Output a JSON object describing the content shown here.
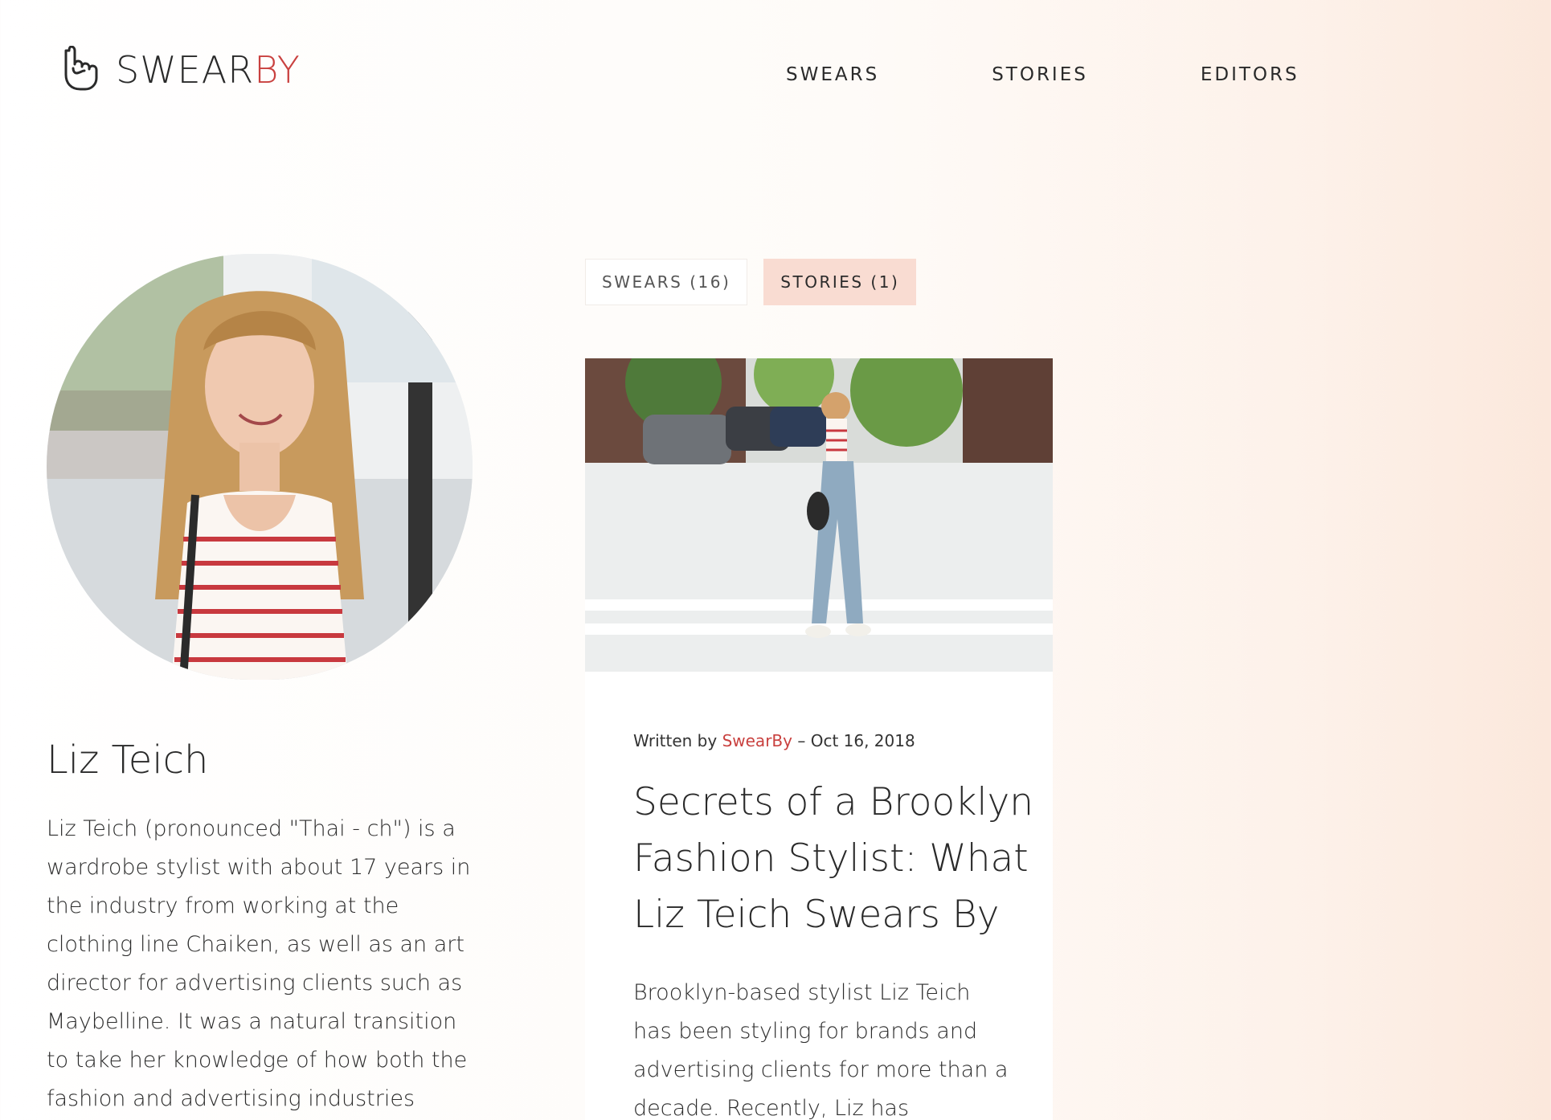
{
  "brand": {
    "name_main": "SWEAR",
    "name_accent": "BY",
    "accent_color": "#c9413f",
    "icon": "hand-icon"
  },
  "nav": {
    "items": [
      {
        "label": "SWEARS"
      },
      {
        "label": "STORIES"
      },
      {
        "label": "EDITORS"
      }
    ]
  },
  "profile": {
    "name": "Liz Teich",
    "bio": "Liz Teich (pronounced \"Thai - ch\") is a wardrobe stylist with about 17 years in the industry from working at the clothing line Chaiken, as well as an art director for advertising clients such as Maybelline. It was a natural transition to take her knowledge of how both the fashion and advertising industries operate and apply it"
  },
  "tabs": [
    {
      "label": "SWEARS (16)",
      "active": false
    },
    {
      "label": "STORIES (1)",
      "active": true
    }
  ],
  "story": {
    "written_by_prefix": "Written by",
    "author": "SwearBy",
    "date_separator": "–",
    "date": "Oct 16, 2018",
    "title": "Secrets of a Brooklyn Fashion Stylist: What Liz Teich Swears By",
    "excerpt": "Brooklyn-based stylist Liz Teich has been styling for brands and advertising clients for more than a decade. Recently, Liz has"
  },
  "colors": {
    "active_tab_bg": "#f9dcd2",
    "text": "#2a2a2a"
  }
}
